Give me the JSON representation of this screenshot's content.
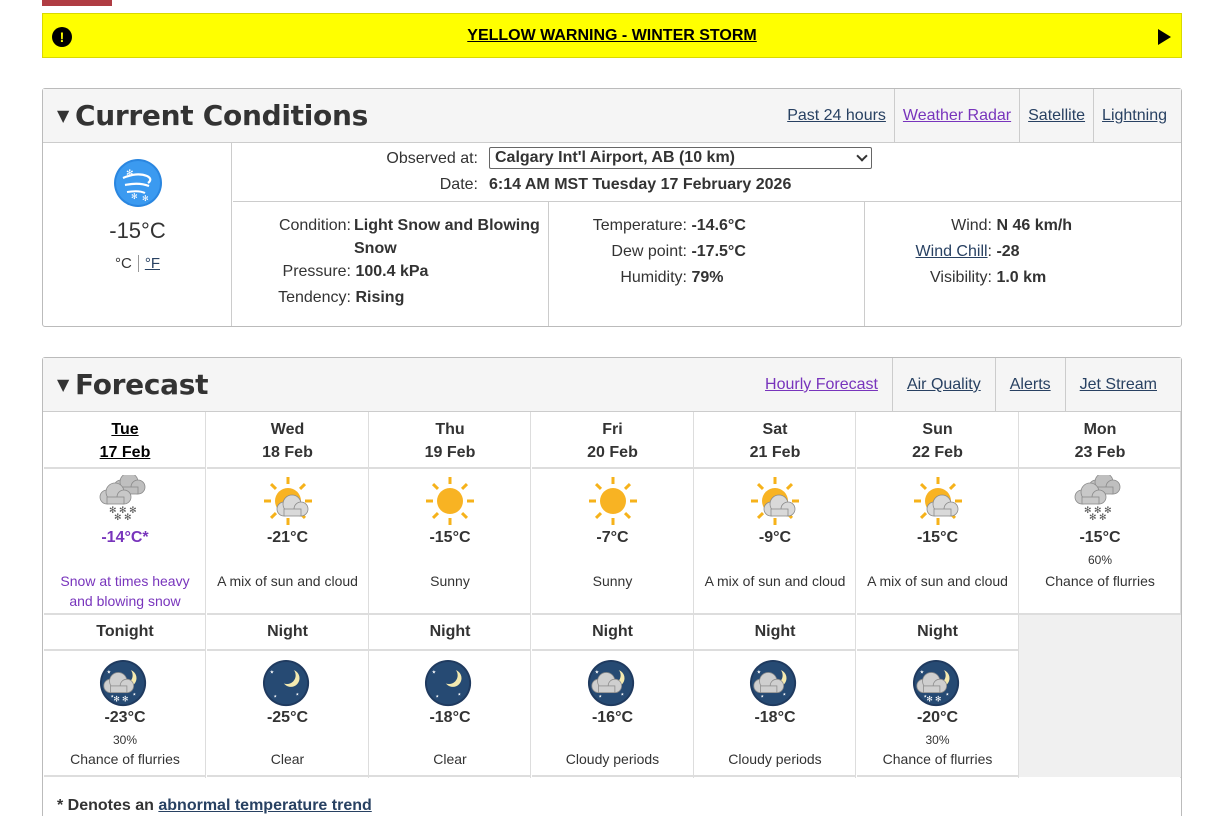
{
  "alert": {
    "title": "YELLOW WARNING - WINTER STORM",
    "icon": "exclamation-icon",
    "color": "#ffff00"
  },
  "current": {
    "heading": "Current Conditions",
    "links": [
      "Past 24 hours",
      "Weather Radar",
      "Satellite",
      "Lightning"
    ],
    "temp": "-15°C",
    "unit_c": "°C",
    "unit_f": "°F",
    "observed_label": "Observed at:",
    "observed_value": "Calgary Int'l Airport, AB (10 km)",
    "date_label": "Date:",
    "date_value": "6:14 AM MST Tuesday 17 February 2026",
    "condition_label": "Condition:",
    "condition_value": "Light Snow and Blowing Snow",
    "pressure_label": "Pressure:",
    "pressure_value": "100.4 kPa",
    "tendency_label": "Tendency:",
    "tendency_value": "Rising",
    "temperature_label": "Temperature:",
    "temperature_value": "-14.6°C",
    "dewpoint_label": "Dew point:",
    "dewpoint_value": "-17.5°C",
    "humidity_label": "Humidity:",
    "humidity_value": "79%",
    "wind_label": "Wind:",
    "wind_value": "N 46 km/h",
    "windchill_label": "Wind Chill",
    "windchill_value": "-28",
    "visibility_label": "Visibility:",
    "visibility_value": "1.0 km"
  },
  "forecast": {
    "heading": "Forecast",
    "links": [
      "Hourly Forecast",
      "Air Quality",
      "Alerts",
      "Jet Stream"
    ],
    "days": [
      {
        "day": "Tue",
        "date": "17 Feb",
        "temp": "-14°C*",
        "pop": "",
        "summary": "Snow at times heavy and blowing snow",
        "icon": "snow-cloud-icon"
      },
      {
        "day": "Wed",
        "date": "18 Feb",
        "temp": "-21°C",
        "pop": "",
        "summary": "A mix of sun and cloud",
        "icon": "sun-cloud-icon"
      },
      {
        "day": "Thu",
        "date": "19 Feb",
        "temp": "-15°C",
        "pop": "",
        "summary": "Sunny",
        "icon": "sun-icon"
      },
      {
        "day": "Fri",
        "date": "20 Feb",
        "temp": "-7°C",
        "pop": "",
        "summary": "Sunny",
        "icon": "sun-icon"
      },
      {
        "day": "Sat",
        "date": "21 Feb",
        "temp": "-9°C",
        "pop": "",
        "summary": "A mix of sun and cloud",
        "icon": "sun-cloud-icon"
      },
      {
        "day": "Sun",
        "date": "22 Feb",
        "temp": "-15°C",
        "pop": "",
        "summary": "A mix of sun and cloud",
        "icon": "sun-cloud-icon"
      },
      {
        "day": "Mon",
        "date": "23 Feb",
        "temp": "-15°C",
        "pop": "60%",
        "summary": "Chance of flurries",
        "icon": "snow-cloud-icon"
      }
    ],
    "nights": [
      {
        "label": "Tonight",
        "temp": "-23°C",
        "pop": "30%",
        "summary": "Chance of flurries",
        "icon": "night-flurries-icon"
      },
      {
        "label": "Night",
        "temp": "-25°C",
        "pop": "",
        "summary": "Clear",
        "icon": "night-clear-icon"
      },
      {
        "label": "Night",
        "temp": "-18°C",
        "pop": "",
        "summary": "Clear",
        "icon": "night-clear-icon"
      },
      {
        "label": "Night",
        "temp": "-16°C",
        "pop": "",
        "summary": "Cloudy periods",
        "icon": "night-cloudy-icon"
      },
      {
        "label": "Night",
        "temp": "-18°C",
        "pop": "",
        "summary": "Cloudy periods",
        "icon": "night-cloudy-icon"
      },
      {
        "label": "Night",
        "temp": "-20°C",
        "pop": "30%",
        "summary": "Chance of flurries",
        "icon": "night-flurries-icon"
      }
    ],
    "note_prefix": "* Denotes an",
    "note_link": "abnormal temperature trend"
  }
}
